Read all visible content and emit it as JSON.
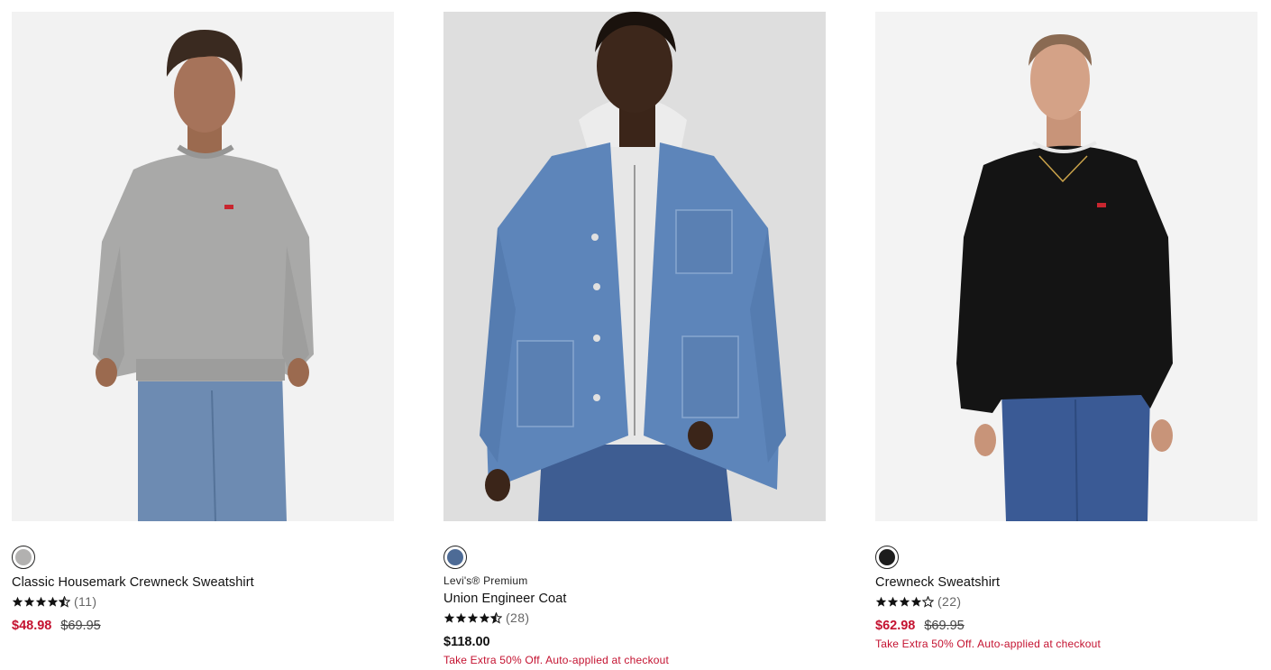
{
  "products": [
    {
      "swatch_color": "#b2b1b0",
      "brand": "",
      "name": "Classic Housemark Crewneck Sweatshirt",
      "rating": 4.5,
      "review_count": "(11)",
      "sale_price": "$48.98",
      "original_price": "$69.95",
      "regular_price": "",
      "promo": "",
      "photo_bg": "#f2f2f2",
      "garment_color": "#a9a9a8",
      "pants_color": "#6d8bb2"
    },
    {
      "swatch_color": "#4d6b96",
      "brand": "Levi's® Premium",
      "name": "Union Engineer Coat",
      "rating": 4.5,
      "review_count": "(28)",
      "sale_price": "",
      "original_price": "",
      "regular_price": "$118.00",
      "promo": "Take Extra 50% Off. Auto-applied at checkout",
      "photo_bg": "#dedede",
      "garment_color": "#5d85ba",
      "pants_color": "#3e5d92"
    },
    {
      "swatch_color": "#1c1c1c",
      "brand": "",
      "name": "Crewneck Sweatshirt",
      "rating": 4,
      "review_count": "(22)",
      "sale_price": "$62.98",
      "original_price": "$69.95",
      "regular_price": "",
      "promo": "Take Extra 50% Off. Auto-applied at checkout",
      "photo_bg": "#f3f3f3",
      "garment_color": "#141414",
      "pants_color": "#3a5a95"
    }
  ],
  "icons": {
    "star_full": "star-icon",
    "star_half": "star-half-icon",
    "star_empty": "star-empty-icon"
  }
}
